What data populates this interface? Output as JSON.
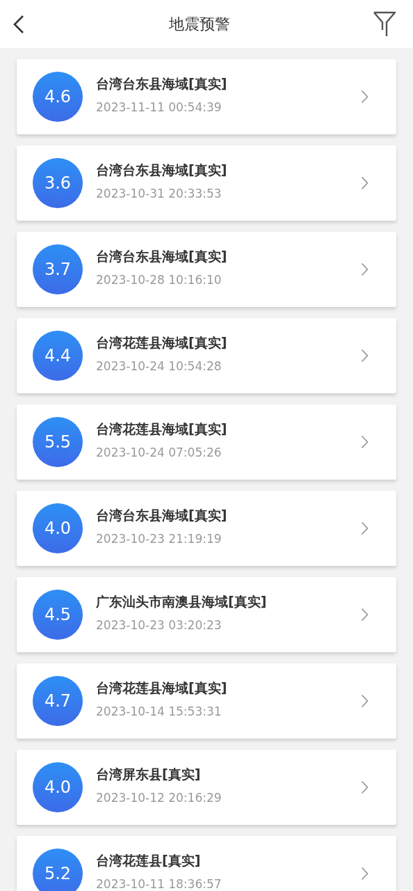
{
  "header": {
    "title": "地震预警"
  },
  "events": [
    {
      "magnitude": "4.6",
      "place": "台湾台东县海域[真实]",
      "time": "2023-11-11 00:54:39"
    },
    {
      "magnitude": "3.6",
      "place": "台湾台东县海域[真实]",
      "time": "2023-10-31 20:33:53"
    },
    {
      "magnitude": "3.7",
      "place": "台湾台东县海域[真实]",
      "time": "2023-10-28 10:16:10"
    },
    {
      "magnitude": "4.4",
      "place": "台湾花莲县海域[真实]",
      "time": "2023-10-24 10:54:28"
    },
    {
      "magnitude": "5.5",
      "place": "台湾花莲县海域[真实]",
      "time": "2023-10-24 07:05:26"
    },
    {
      "magnitude": "4.0",
      "place": "台湾台东县海域[真实]",
      "time": "2023-10-23 21:19:19"
    },
    {
      "magnitude": "4.5",
      "place": "广东汕头市南澳县海域[真实]",
      "time": "2023-10-23 03:20:23"
    },
    {
      "magnitude": "4.7",
      "place": "台湾花莲县海域[真实]",
      "time": "2023-10-14 15:53:31"
    },
    {
      "magnitude": "4.0",
      "place": "台湾屏东县[真实]",
      "time": "2023-10-12 20:16:29"
    },
    {
      "magnitude": "5.2",
      "place": "台湾花莲县[真实]",
      "time": "2023-10-11 18:36:57"
    }
  ]
}
